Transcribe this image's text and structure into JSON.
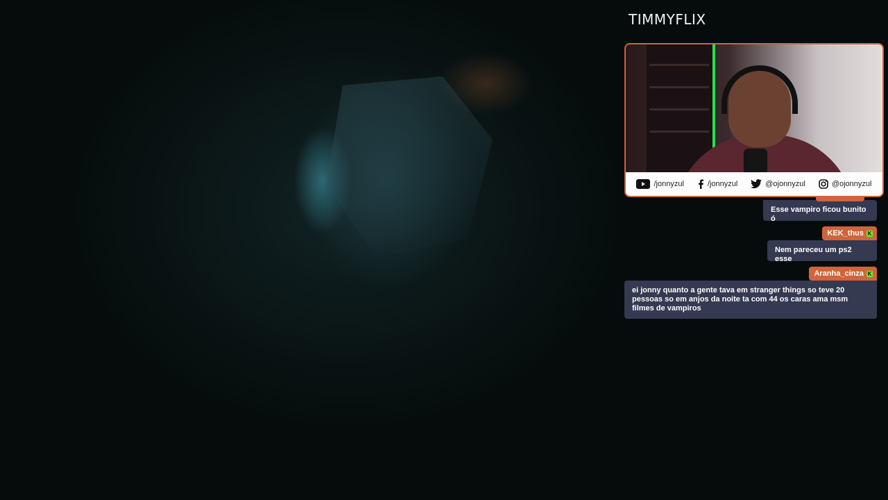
{
  "channel": {
    "title": "TIMMYFLIX"
  },
  "socials": [
    {
      "icon": "youtube-icon",
      "handle": "/jonnyzul"
    },
    {
      "icon": "facebook-icon",
      "handle": "/jonnyzul"
    },
    {
      "icon": "twitter-icon",
      "handle": "@ojonnyzul"
    },
    {
      "icon": "instagram-icon",
      "handle": "@ojonnyzul"
    }
  ],
  "chat": {
    "messages": [
      {
        "user": "",
        "text": "Esse vampiro ficou bunito ó"
      },
      {
        "user": "KEK_thus",
        "badge": "kick-icon",
        "text": "Nem pareceu um ps2 esse"
      },
      {
        "user": "Aranha_cinza",
        "badge": "kick-icon",
        "text": "ei jonny quanto a gente tava em stranger things so teve 20 pessoas so em anjos da noite ta com 44 os caras ama msm filmes de vampiros"
      }
    ]
  },
  "colors": {
    "accent": "#d0643a",
    "bubble": "#353a52",
    "kick_badge": "#53fc18"
  }
}
